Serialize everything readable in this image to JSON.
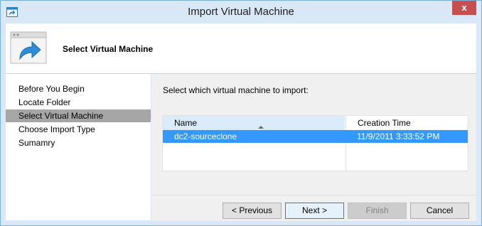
{
  "window": {
    "title": "Import Virtual Machine",
    "close_label": "x"
  },
  "header": {
    "title": "Select Virtual Machine",
    "icon": "import-arrow-icon"
  },
  "sidebar": {
    "items": [
      {
        "label": "Before You Begin",
        "active": false
      },
      {
        "label": "Locate Folder",
        "active": false
      },
      {
        "label": "Select Virtual Machine",
        "active": true
      },
      {
        "label": "Choose Import Type",
        "active": false
      },
      {
        "label": "Sumamry",
        "active": false
      }
    ]
  },
  "main": {
    "instruction": "Select which virtual machine to import:",
    "table": {
      "columns": [
        "Name",
        "Creation Time"
      ],
      "sorted_column": "Name",
      "rows": [
        {
          "name": "dc2-sourceclone",
          "creation_time": "11/9/2011 3:33:52 PM",
          "selected": true
        }
      ]
    }
  },
  "buttons": {
    "previous": "< Previous",
    "next": "Next >",
    "finish": "Finish",
    "cancel": "Cancel"
  },
  "colors": {
    "selection": "#3399ff",
    "active_step": "#a6a6a6",
    "title_bar": "#d9e8f7",
    "close_button": "#c74f50"
  }
}
